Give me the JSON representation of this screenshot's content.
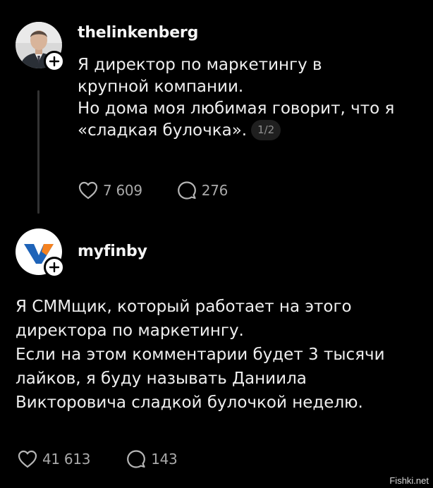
{
  "post1": {
    "username": "thelinkenberg",
    "lines": [
      "Я директор по маркетингу в",
      "крупной компании.",
      "Но дома моя любимая говорит, что я",
      "«сладкая булочка»."
    ],
    "page_indicator": "1/2",
    "likes": "7 609",
    "comments": "276"
  },
  "post2": {
    "username": "myfinby",
    "lines": [
      "Я СММщик, который работает на этого",
      "директора по маркетингу.",
      "Если на этом комментарии будет 3 тысячи",
      "лайков, я буду называть Даниила",
      "Викторовича сладкой булочкой неделю."
    ],
    "likes": "41 613",
    "comments": "143"
  },
  "watermark": "Fishki.net",
  "colors": {
    "background": "#000000",
    "text": "#efefef",
    "muted": "#a9a9a9",
    "thread_line": "#333333",
    "logo_blue": "#1e63b8",
    "logo_orange": "#f58220"
  },
  "icons": {
    "like": "heart-icon",
    "comment": "speech-bubble-icon",
    "follow": "plus-icon"
  }
}
